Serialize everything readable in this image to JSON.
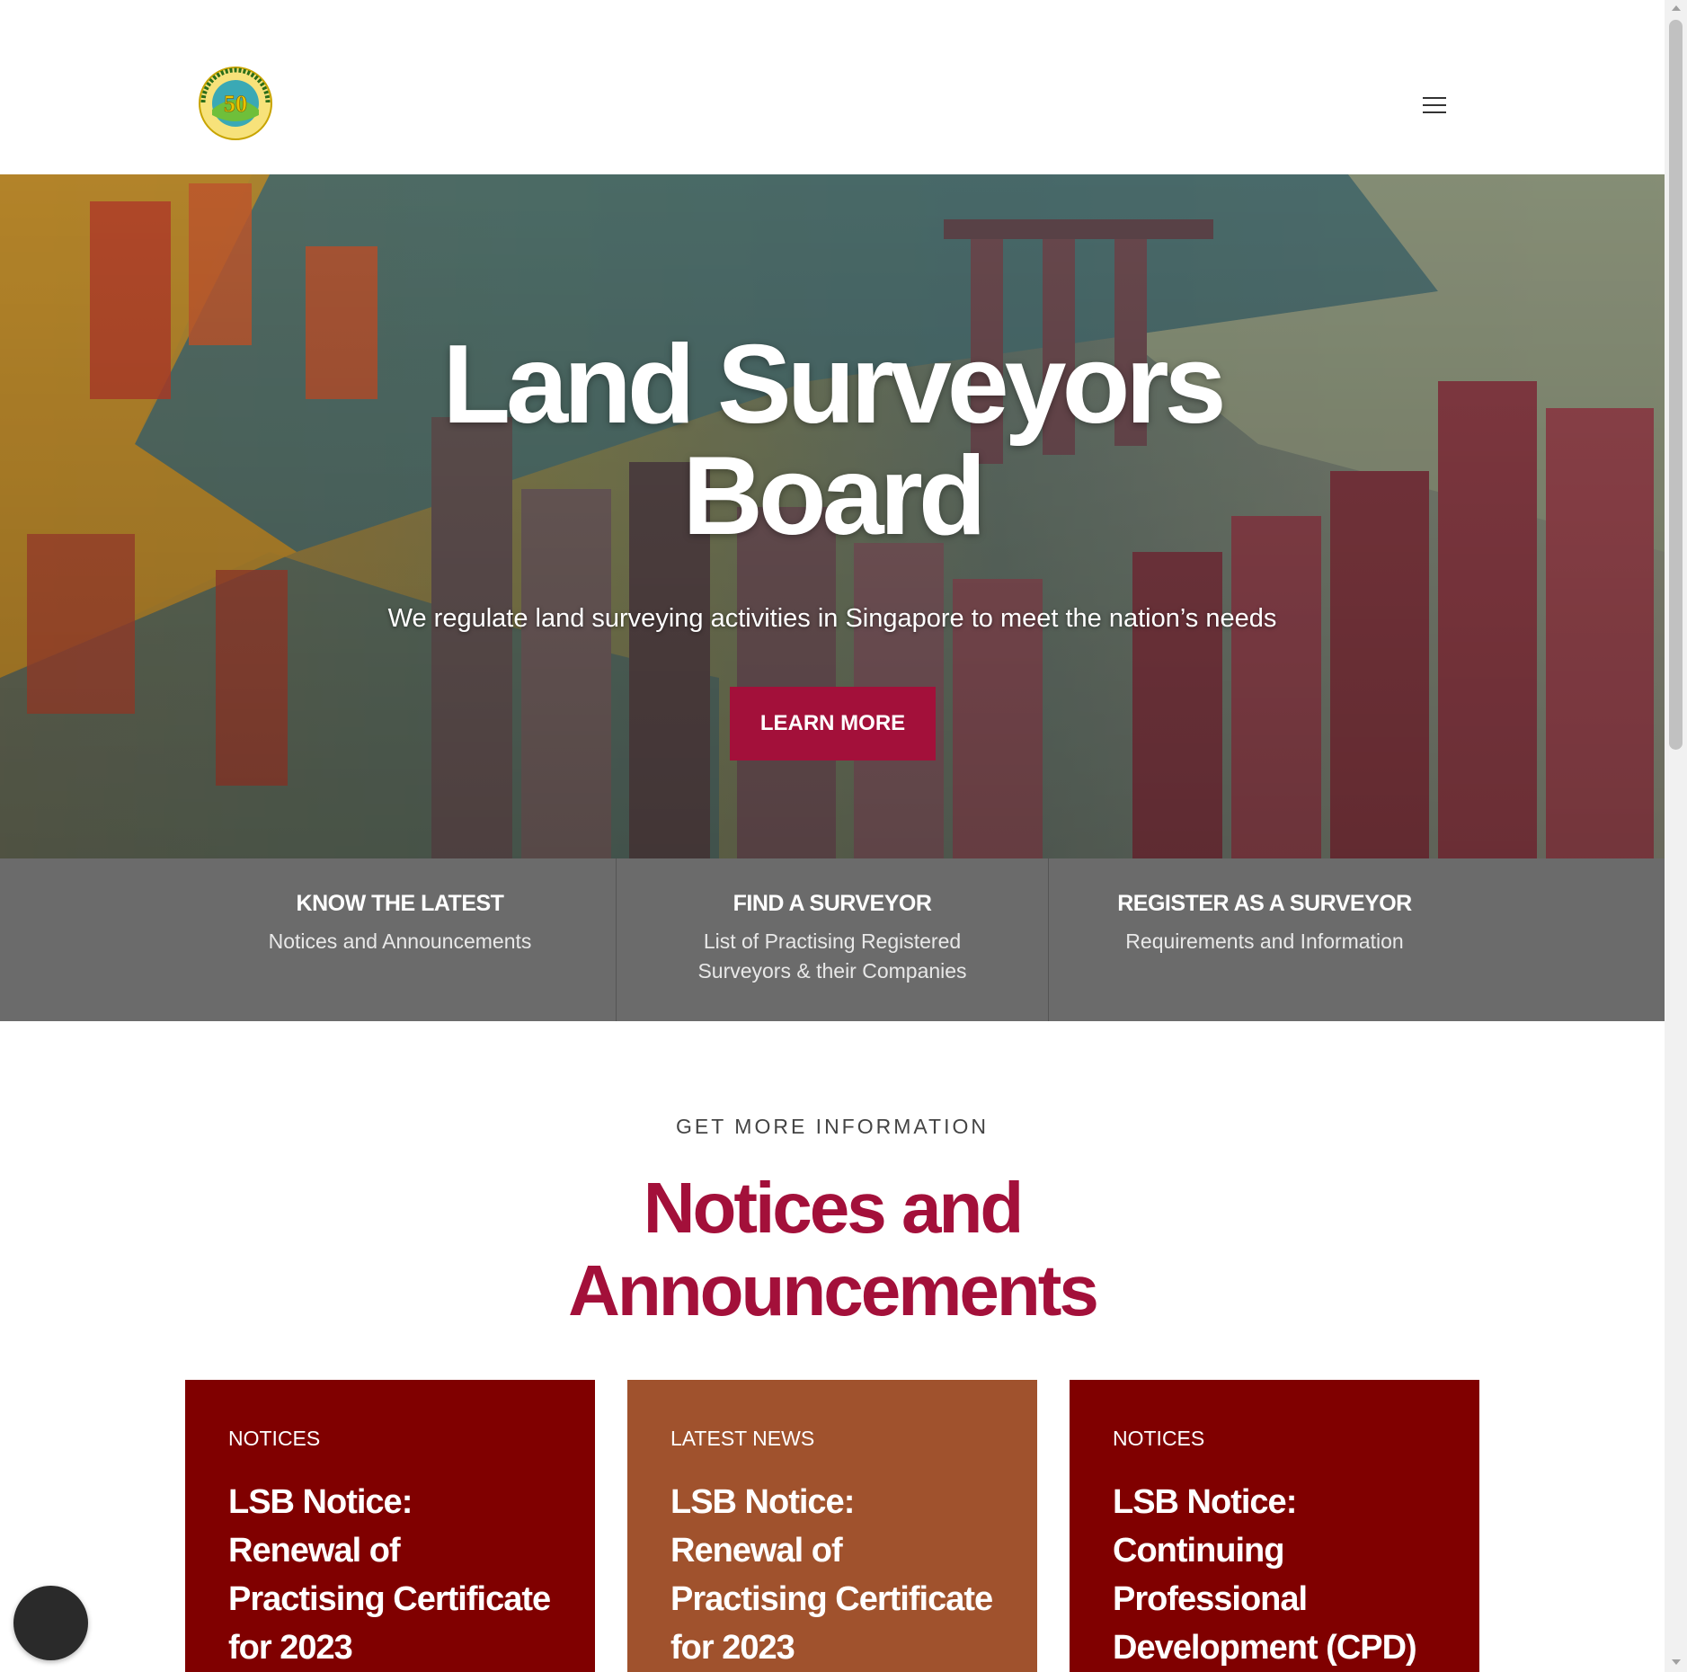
{
  "header": {
    "logo_alt": "LAND SURVEYORS BOARD 50",
    "menu_icon": "hamburger-menu-icon"
  },
  "hero": {
    "title_line1": "Land Surveyors",
    "title_line2": "Board",
    "subtitle": "We regulate land surveying activities in Singapore to meet the nation’s needs",
    "button_label": "LEARN MORE"
  },
  "quick_links": [
    {
      "title": "KNOW THE LATEST",
      "subtitle": "Notices and Announcements"
    },
    {
      "title": "FIND A SURVEYOR",
      "subtitle": "List of Practising Registered Surveyors & their Companies"
    },
    {
      "title": "REGISTER AS A SURVEYOR",
      "subtitle": "Requirements and Information"
    }
  ],
  "notices": {
    "label": "GET MORE INFORMATION",
    "title_line1": "Notices and",
    "title_line2": "Announcements",
    "cards": [
      {
        "category": "NOTICES",
        "title": "LSB Notice: Renewal of Practising Certificate for 2023"
      },
      {
        "category": "LATEST NEWS",
        "title": "LSB Notice: Renewal of Practising Certificate for 2023"
      },
      {
        "category": "NOTICES",
        "title": "LSB Notice: Continuing Professional Development (CPD)"
      }
    ]
  },
  "colors": {
    "accent": "#a3103a",
    "card_red": "#800000",
    "card_brown": "#a0522d",
    "quick_bar": "#6b6b6b"
  }
}
